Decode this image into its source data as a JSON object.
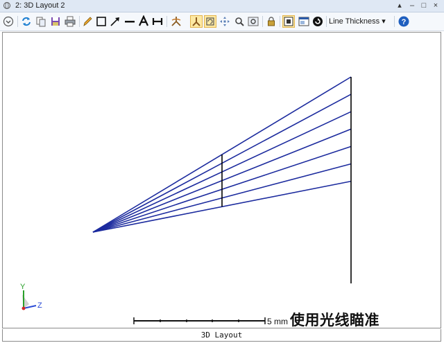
{
  "window": {
    "title": "2: 3D Layout 2",
    "controls": [
      "▴",
      "–",
      "□",
      "×"
    ]
  },
  "toolbar": {
    "icons": [
      "dropdown-circle-icon",
      "refresh-icon",
      "copy-icon",
      "save-image-icon",
      "print-icon",
      "pencil-icon",
      "rectangle-icon",
      "arrow-icon",
      "line-icon",
      "text-icon",
      "dimension-icon",
      "rotate-icon",
      "axis-icon",
      "rotate-view-icon",
      "pan-icon",
      "zoom-icon",
      "zoom-window-icon",
      "lock-icon",
      "fit-view-icon",
      "window-icon",
      "reset-icon",
      "help-icon"
    ],
    "line_thickness_label": "Line Thickness",
    "line_thickness_arrow": "▾"
  },
  "colors": {
    "ray": "#1c2b9e",
    "element": "#000000",
    "axis_y": "#2aa02a",
    "axis_z": "#2a4ad6",
    "axis_x": "#d02a2a",
    "active_tool": "#fde9a3"
  },
  "plot": {
    "axis_y_label": "Y",
    "axis_z_label": "Z",
    "scale_bar_label": "5 mm",
    "ray_count": 7
  },
  "caption": "使用光线瞄准",
  "footer_label": "3D Layout"
}
